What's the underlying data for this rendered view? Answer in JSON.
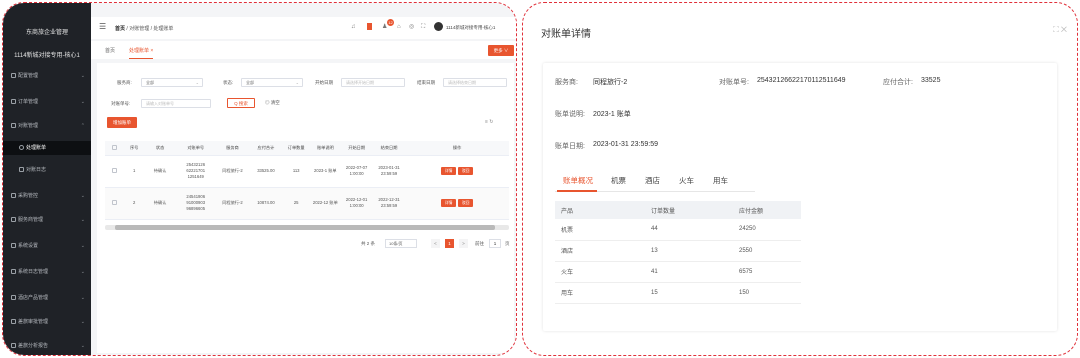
{
  "sidebar": {
    "title": "东商旅企业管理",
    "subtitle": "1114新城对接专用-核心1",
    "items": [
      {
        "label": "配置管理"
      },
      {
        "label": "订单管理"
      },
      {
        "label": "对账管理"
      },
      {
        "label": "处理账单"
      },
      {
        "label": "对账日志"
      },
      {
        "label": "采购管控"
      },
      {
        "label": "服务商管理"
      },
      {
        "label": "系统设置"
      },
      {
        "label": "系统日志管理"
      },
      {
        "label": "酒店产品管理"
      },
      {
        "label": "差旅审批管理"
      },
      {
        "label": "差旅分析报告"
      }
    ]
  },
  "topbar": {
    "breadcrumb": [
      "首页",
      "对账管理",
      "处理账单"
    ],
    "notification_count": "12",
    "user": "1114新城对接专用-核心1"
  },
  "tabs": {
    "items": [
      "首页",
      "处理账单 ×"
    ],
    "more_label": "更多 ∨"
  },
  "filters": {
    "provider_label": "服务商:",
    "provider_value": "全部",
    "status_label": "状态:",
    "status_value": "全部",
    "start_label": "开始日期",
    "start_placeholder": "请选择开始日期",
    "end_label": "结束日期",
    "end_placeholder": "请选择结束日期",
    "bill_no_label": "对账单号:",
    "bill_no_placeholder": "请输入对账单号",
    "search_label": "Q 搜索",
    "reset_label": "◎ 清空",
    "add_label": "增加账单",
    "tool_icons": "≡  ↻"
  },
  "table": {
    "headers": [
      "",
      "序号",
      "状态",
      "对账单号",
      "服务商",
      "应付合计",
      "订单数量",
      "账单说明",
      "开始日期",
      "结束日期",
      "操作"
    ],
    "rows": [
      {
        "index": "1",
        "status": "待确认",
        "bill_no": "25432126 62221701 1251649",
        "provider": "同程旅行-2",
        "total": "33525.00",
        "count": "113",
        "desc": "2023-1 账单",
        "start": "2022-07-07 1:00:00",
        "end": "2023-01-31 23:59:59",
        "op1": "详情",
        "op2": "驳回"
      },
      {
        "index": "2",
        "status": "待确认",
        "bill_no": "24541906 91000903 96896605",
        "provider": "同程旅行-2",
        "total": "10874.00",
        "count": "25",
        "desc": "2022-12 账单",
        "start": "2022-12-01 1:00:00",
        "end": "2022-12-31 23:59:59",
        "op1": "详情",
        "op2": "驳回"
      }
    ]
  },
  "pager": {
    "total": "共 2 条",
    "size": "10条/页",
    "prev": "<",
    "page": "1",
    "next": ">",
    "goto": "前往",
    "goto_value": "1",
    "suffix": "页"
  },
  "detail": {
    "title": "对账单详情",
    "window_icons": "⛶ ✕",
    "provider_label": "服务商:",
    "provider_value": "同程旅行-2",
    "bill_no_label": "对账单号:",
    "bill_no_value": "25432126622170112511649",
    "total_label": "应付合计:",
    "total_value": "33525",
    "desc_label": "账单说明:",
    "desc_value": "2023-1 账单",
    "date_label": "账单日期:",
    "date_value": "2023-01-31 23:59:59",
    "tabs": [
      "账单概况",
      "机票",
      "酒店",
      "火车",
      "用车"
    ],
    "table_headers": [
      "产品",
      "订单数量",
      "应付金额"
    ],
    "table_rows": [
      {
        "product": "机票",
        "count": "44",
        "amount": "24250"
      },
      {
        "product": "酒店",
        "count": "13",
        "amount": "2550"
      },
      {
        "product": "火车",
        "count": "41",
        "amount": "6575"
      },
      {
        "product": "用车",
        "count": "15",
        "amount": "150"
      }
    ]
  },
  "colors": {
    "accent": "#e8552f",
    "sidebar_bg": "#1f2227",
    "frame_dash": "#e0303a"
  }
}
